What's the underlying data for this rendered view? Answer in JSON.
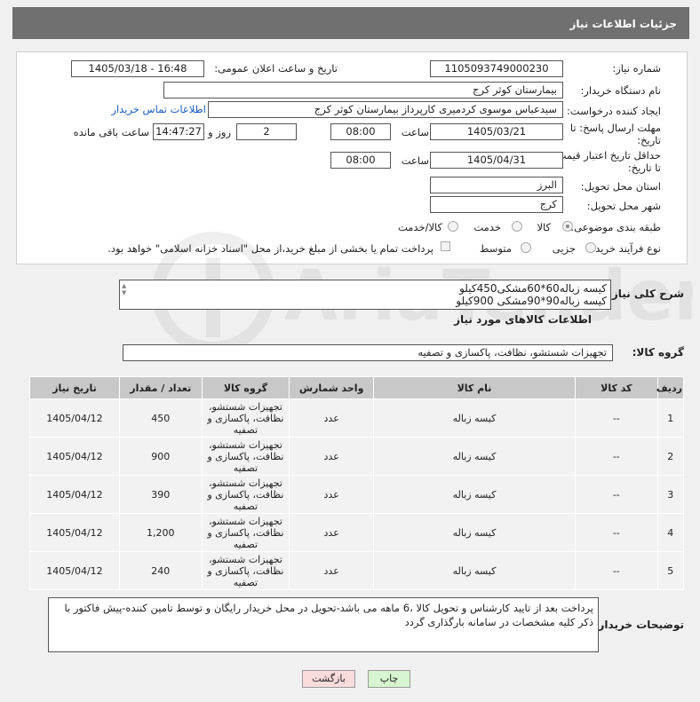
{
  "header": {
    "title": "جزئیات اطلاعات نیاز"
  },
  "form": {
    "need_number_label": "شماره نیاز:",
    "need_number": "1105093749000230",
    "announce_label": "تاریخ و ساعت اعلان عمومی:",
    "announce_value": "1405/03/18 - 16:48",
    "buyer_org_label": "نام دستگاه خریدار:",
    "buyer_org": "بیمارستان کوثر کرج",
    "creator_label": "ایجاد کننده درخواست:",
    "creator": "سیدعباس موسوی کردمیری کارپرداز بیمارستان کوثر کرج",
    "contact_link": "اطلاعات تماس خریدار",
    "deadline_label_1": "مهلت ارسال پاسخ: تا",
    "deadline_label_2": "تاریخ:",
    "deadline_date": "1405/03/21",
    "time_label": "ساعت",
    "deadline_time": "08:00",
    "days_value": "2",
    "days_label": "روز و",
    "remaining_time": "14:47:27",
    "remaining_label": "ساعت باقی مانده",
    "price_label_1": "حداقل تاریخ اعتبار قیمت:",
    "price_label_2": "تا تاریخ:",
    "price_date": "1405/04/31",
    "price_time": "08:00",
    "province_label": "استان محل تحویل:",
    "province": "البرز",
    "city_label": "شهر محل تحویل:",
    "city": "کرج",
    "category_label": "طبقه بندی موضوعی:",
    "category_options": [
      "کالا",
      "خدمت",
      "کالا/خدمت"
    ],
    "process_label": "نوع فرآیند خرید :",
    "process_options": [
      "جزیی",
      "متوسط"
    ],
    "payment_note": "پرداخت تمام یا بخشی از مبلغ خرید،از محل \"اسناد خزانه اسلامی\" خواهد بود."
  },
  "description": {
    "label": "شرح کلی نیاز:",
    "lines": [
      "کیسه زباله60*60مشکی450کیلو",
      "کیسه زباله90*90مشکی 900کیلو"
    ]
  },
  "goods_section_title": "اطلاعات کالاهای مورد نیاز",
  "goods_group": {
    "label": "گروه کالا:",
    "value": "تجهیزات شستشو، نظافت، پاکسازی و تصفیه"
  },
  "table": {
    "headers": [
      "ردیف",
      "کد کالا",
      "نام کالا",
      "واحد شمارش",
      "گروه کالا",
      "تعداد / مقدار",
      "تاریخ نیاز"
    ],
    "rows": [
      {
        "idx": "1",
        "code": "--",
        "name": "کیسه زباله",
        "unit": "عدد",
        "group": "تجهیزات شستشو، نظافت، پاکسازی و تصفیه",
        "qty": "450",
        "date": "1405/04/12"
      },
      {
        "idx": "2",
        "code": "--",
        "name": "کیسه زباله",
        "unit": "عدد",
        "group": "تجهیزات شستشو، نظافت، پاکسازی و تصفیه",
        "qty": "900",
        "date": "1405/04/12"
      },
      {
        "idx": "3",
        "code": "--",
        "name": "کیسه زباله",
        "unit": "عدد",
        "group": "تجهیزات شستشو، نظافت، پاکسازی و تصفیه",
        "qty": "390",
        "date": "1405/04/12"
      },
      {
        "idx": "4",
        "code": "--",
        "name": "کیسه زباله",
        "unit": "عدد",
        "group": "تجهیزات شستشو، نظافت، پاکسازی و تصفیه",
        "qty": "1,200",
        "date": "1405/04/12"
      },
      {
        "idx": "5",
        "code": "--",
        "name": "کیسه زباله",
        "unit": "عدد",
        "group": "تجهیزات شستشو، نظافت، پاکسازی و تصفیه",
        "qty": "240",
        "date": "1405/04/12"
      }
    ]
  },
  "buyer_notes": {
    "label": "توضیحات خریدار:",
    "text": "پرداخت بعد از تایید کارشناس و تحویل کالا ،6 ماهه می باشد-تحویل در محل خریدار رایگان و توسط تامین کننده-پیش فاکتور با ذکر کلیه مشخصات در سامانه بارگذاری گردد"
  },
  "buttons": {
    "print": "چاپ",
    "back": "بازگشت"
  },
  "watermark": {
    "brand": "AriaTender.neT"
  },
  "colors": {
    "header_bg": "#707070",
    "link": "#1a5bbf",
    "print_btn": "#d7f5d0",
    "back_btn": "#fbdcdc"
  }
}
